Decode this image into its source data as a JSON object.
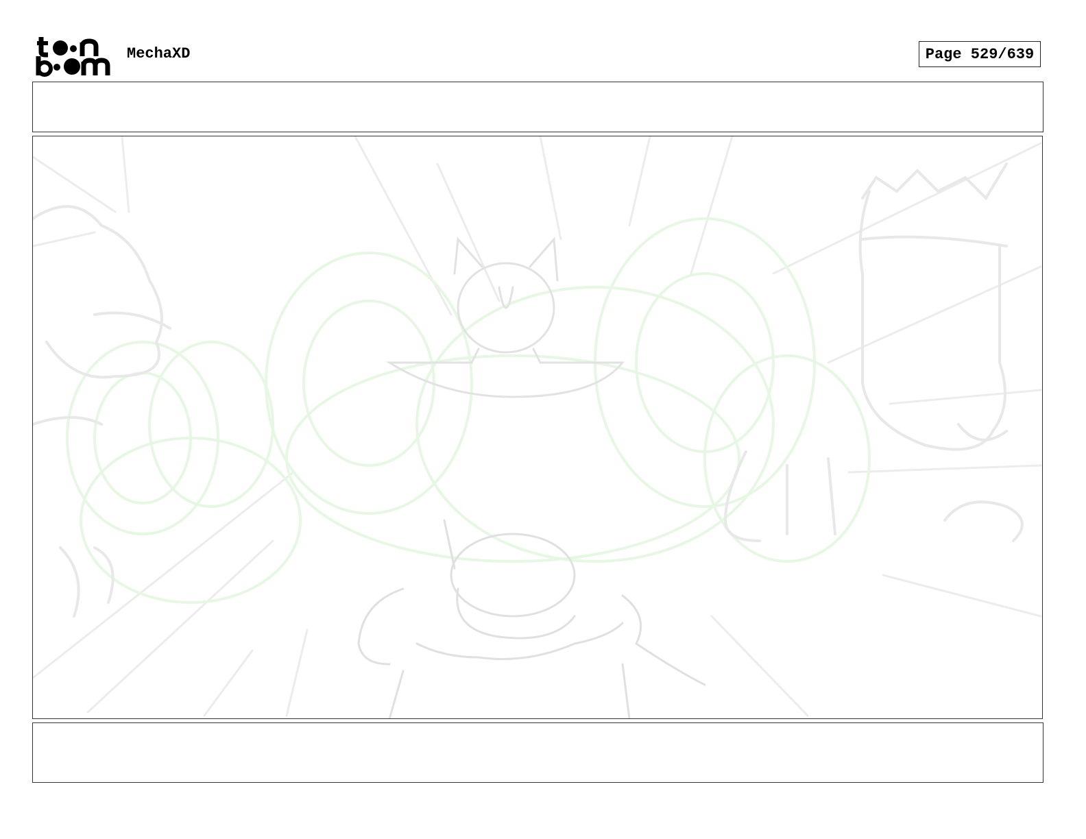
{
  "header": {
    "logo_text": "toon boom",
    "project_title": "MechaXD",
    "page_label": "Page 529/639"
  },
  "panel": {
    "sketch_colors": {
      "gray": "#e6e6e6",
      "green": "#dff7dc"
    }
  },
  "dialogue": {
    "text": ""
  },
  "notes": {
    "text": ""
  }
}
